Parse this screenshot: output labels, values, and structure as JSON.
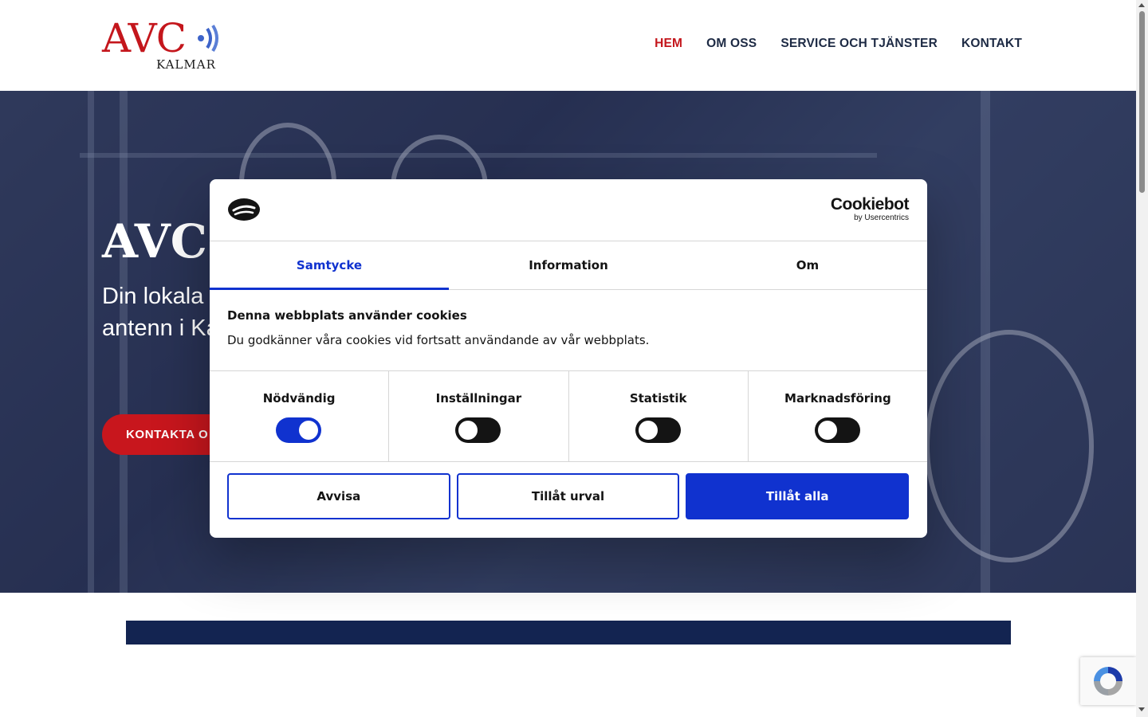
{
  "site": {
    "logo_main": "AVC",
    "logo_sub": "KALMAR"
  },
  "nav": {
    "items": [
      {
        "label": "HEM",
        "active": true
      },
      {
        "label": "OM OSS",
        "active": false
      },
      {
        "label": "SERVICE OCH TJÄNSTER",
        "active": false
      },
      {
        "label": "KONTAKT",
        "active": false
      }
    ]
  },
  "hero": {
    "title": "AVC-",
    "subtitle_line1": "Din lokala",
    "subtitle_line2": "antenn i Ka",
    "button_label": "KONTAKTA O"
  },
  "cookie": {
    "brand_name": "Cookiebot",
    "brand_by": "by Usercentrics",
    "tabs": [
      {
        "label": "Samtycke",
        "active": true
      },
      {
        "label": "Information",
        "active": false
      },
      {
        "label": "Om",
        "active": false
      }
    ],
    "heading": "Denna webbplats använder cookies",
    "text": "Du godkänner våra cookies vid fortsatt användande av vår webbplats.",
    "categories": [
      {
        "label": "Nödvändig",
        "enabled": true
      },
      {
        "label": "Inställningar",
        "enabled": false
      },
      {
        "label": "Statistik",
        "enabled": false
      },
      {
        "label": "Marknadsföring",
        "enabled": false
      }
    ],
    "buttons": {
      "reject": "Avvisa",
      "selection": "Tillåt urval",
      "all": "Tillåt alla"
    }
  },
  "colors": {
    "brand_red": "#c4161c",
    "nav_text": "#1d2a44",
    "cookie_blue": "#1032cf",
    "navy_bar": "#132451"
  }
}
